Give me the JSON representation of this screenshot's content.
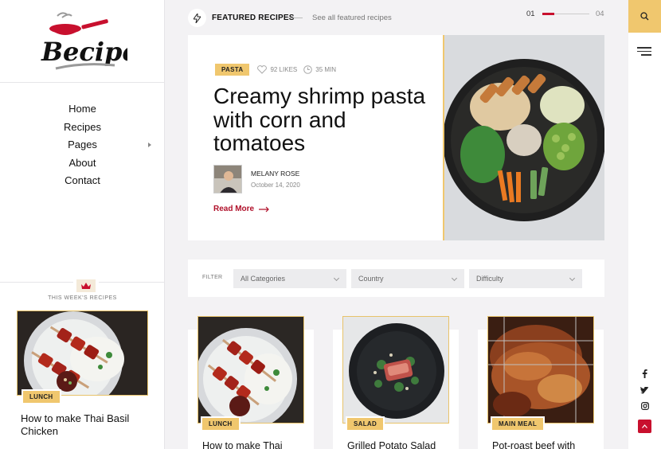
{
  "brand": {
    "logo_text": "Becipe"
  },
  "nav": {
    "items": [
      {
        "label": "Home"
      },
      {
        "label": "Recipes"
      },
      {
        "label": "Pages",
        "has_submenu": true
      },
      {
        "label": "About"
      },
      {
        "label": "Contact"
      }
    ]
  },
  "weekly": {
    "label": "THIS WEEK'S RECIPES",
    "tag": "LUNCH",
    "title": "How to make Thai Basil Chicken"
  },
  "featured": {
    "label": "FEATURED RECIPES",
    "see_all": "See all featured recipes",
    "page_current": "01",
    "page_total": "04",
    "progress_fraction": 0.25
  },
  "hero": {
    "tag": "PASTA",
    "likes": "92 LIKES",
    "time": "35 MIN",
    "title": "Creamy shrimp pasta with corn and tomatoes",
    "author": "MELANY ROSE",
    "date": "October 14, 2020",
    "read_more": "Read More"
  },
  "filter": {
    "label": "FILTER",
    "selects": [
      {
        "value": "All Categories"
      },
      {
        "value": "Country"
      },
      {
        "value": "Difficulty"
      }
    ]
  },
  "cards": [
    {
      "tag": "LUNCH",
      "title": "How to make Thai"
    },
    {
      "tag": "SALAD",
      "title": "Grilled Potato Salad"
    },
    {
      "tag": "MAIN MEAL",
      "title": "Pot-roast beef with"
    }
  ],
  "colors": {
    "accent": "#f0c76e",
    "brand_red": "#c8102e",
    "link_red": "#b0102a"
  },
  "icons": [
    "search-icon",
    "menu-icon",
    "facebook-icon",
    "twitter-icon",
    "instagram-icon",
    "arrow-up-icon",
    "bolt-icon",
    "heart-icon",
    "clock-icon",
    "arrow-right-icon",
    "crown-icon"
  ]
}
